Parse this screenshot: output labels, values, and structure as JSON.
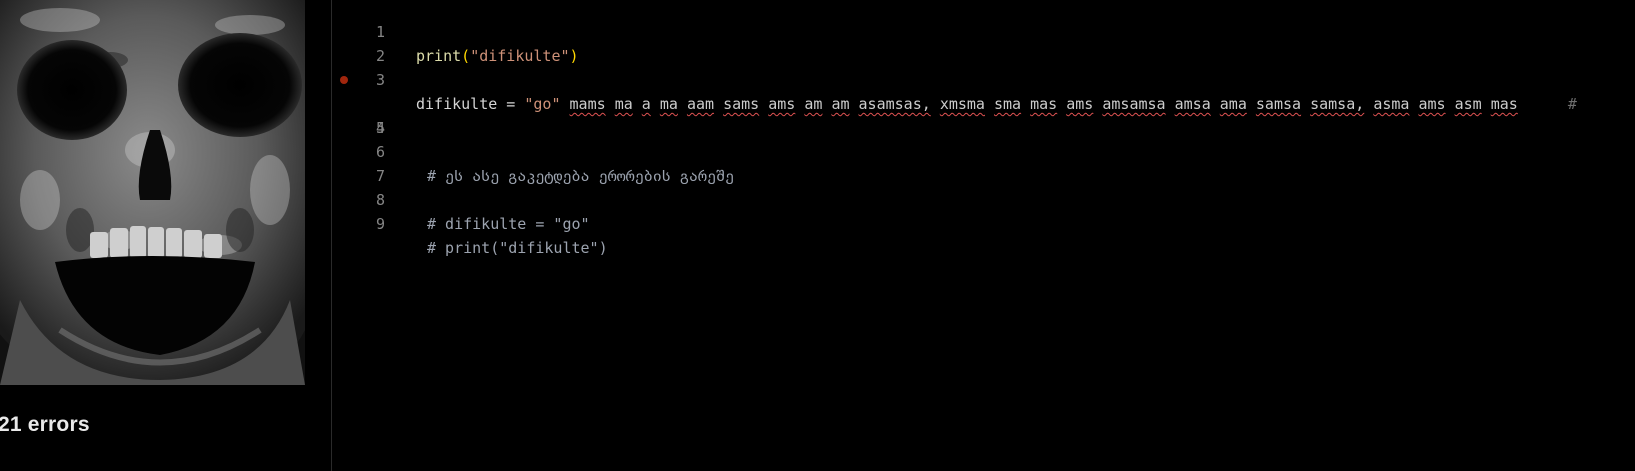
{
  "error_panel": {
    "error_count_text": "21 errors"
  },
  "editor": {
    "lines": [
      {
        "number": "1"
      },
      {
        "number": "2"
      },
      {
        "number": "3"
      },
      {
        "number": "4",
        "breakpoint": true
      },
      {
        "number": "5"
      },
      {
        "number": "6"
      },
      {
        "number": "7"
      },
      {
        "number": "8"
      },
      {
        "number": "9"
      }
    ],
    "line1": {
      "fn": "print",
      "open": "(",
      "str": "\"difikulte\"",
      "close": ")"
    },
    "line3": {
      "var": "difikulte = ",
      "str": "\"go\"",
      "tokens": [
        "mams",
        "ma",
        "a",
        "ma",
        "aam",
        "sams",
        "ams",
        "am",
        "am",
        "asamsas,",
        "xmsma",
        "sma",
        "mas",
        "ams",
        "amsamsa",
        "amsa",
        "ama",
        "samsa",
        "samsa,",
        "asma",
        "ams",
        "asm",
        "mas"
      ],
      "overflow": "#"
    },
    "line6": "# ეს ასე გაკეტდება ერორების გარეშე",
    "line8": "# difikulte = \"go\"",
    "line9": "# print(\"difikulte\")"
  },
  "colors": {
    "background": "#000000",
    "error_underline": "#e05252",
    "string": "#ce9178",
    "function": "#dcdcaa",
    "bracket": "#ffd700",
    "comment": "#9ca3af",
    "breakpoint": "#a1260d"
  }
}
